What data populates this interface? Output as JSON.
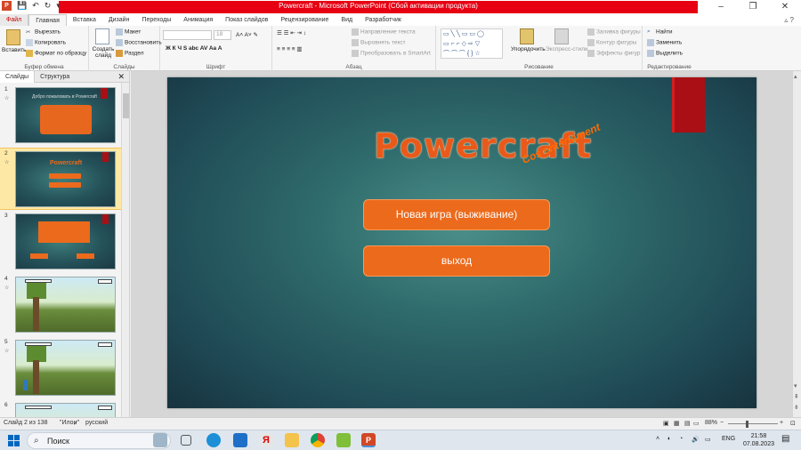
{
  "window": {
    "title": "Powercraft  -  Microsoft PowerPoint (Сбой активации продукта)",
    "app_icon": "P"
  },
  "tabs": [
    {
      "label": "Файл"
    },
    {
      "label": "Главная"
    },
    {
      "label": "Вставка"
    },
    {
      "label": "Дизайн"
    },
    {
      "label": "Переходы"
    },
    {
      "label": "Анимация"
    },
    {
      "label": "Показ слайдов"
    },
    {
      "label": "Рецензирование"
    },
    {
      "label": "Вид"
    },
    {
      "label": "Разработчик"
    }
  ],
  "ribbon": {
    "clipboard": {
      "paste": "Вставить",
      "cut": "Вырезать",
      "copy": "Копировать",
      "format": "Формат по образцу",
      "label": "Буфер обмена"
    },
    "slides": {
      "new": "Создать слайд",
      "layout": "Макет",
      "reset": "Восстановить",
      "section": "Раздел",
      "label": "Слайды"
    },
    "font": {
      "size": "18",
      "label": "Шрифт"
    },
    "paragraph": {
      "direction": "Направление текста",
      "align": "Выровнять текст",
      "smartart": "Преобразовать в SmartArt",
      "label": "Абзац"
    },
    "drawing": {
      "arrange": "Упорядочить",
      "express": "Экспресс-стили",
      "fill": "Заливка фигуры",
      "outline": "Контур фигуры",
      "effects": "Эффекты фигур",
      "label": "Рисование"
    },
    "editing": {
      "find": "Найти",
      "replace": "Заменить",
      "select": "Выделить",
      "label": "Редактирование"
    }
  },
  "panel": {
    "tabs": [
      "Слайды",
      "Структура"
    ],
    "thumbs": [
      {
        "num": "1",
        "title": "Добро пожаловать в Powercraft"
      },
      {
        "num": "2",
        "title": "Powercraft"
      },
      {
        "num": "3",
        "title": ""
      },
      {
        "num": "4",
        "title": ""
      },
      {
        "num": "5",
        "title": ""
      },
      {
        "num": "6",
        "title": ""
      }
    ]
  },
  "slide": {
    "title": "Powercraft",
    "subtitle": "Cos entertament",
    "btn1": "Новая игра (выживание)",
    "btn2": "выход"
  },
  "status": {
    "slide_info": "Слайд 2 из 138",
    "theme": "\"Илон\"",
    "language": "русский",
    "zoom": "88%"
  },
  "taskbar": {
    "search": "Поиск",
    "lang": "ENG",
    "time": "21:58",
    "date": "07.08.2023"
  }
}
